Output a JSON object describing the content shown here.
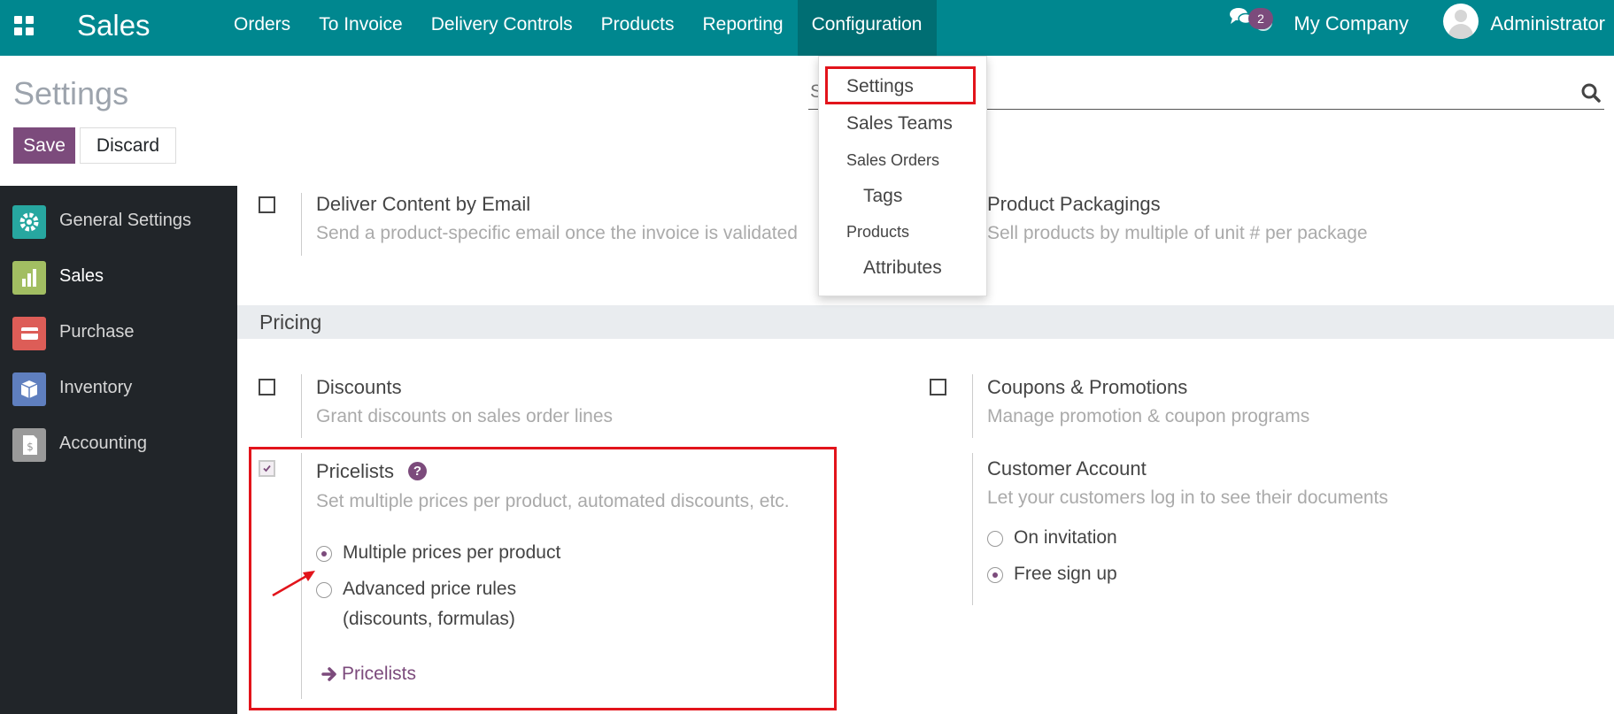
{
  "navbar": {
    "app_title": "Sales",
    "menu": [
      "Orders",
      "To Invoice",
      "Delivery Controls",
      "Products",
      "Reporting",
      "Configuration"
    ],
    "active_menu": "Configuration",
    "message_count": "2",
    "company": "My Company",
    "user": "Administrator"
  },
  "control_panel": {
    "title": "Settings",
    "save_label": "Save",
    "discard_label": "Discard",
    "search_placeholder": "S"
  },
  "sidebar": {
    "items": [
      {
        "label": "General Settings",
        "icon": "gear-icon",
        "color": "#27a7a0"
      },
      {
        "label": "Sales",
        "icon": "sales-chart-icon",
        "color": "#a2be62"
      },
      {
        "label": "Purchase",
        "icon": "credit-card-icon",
        "color": "#dd5d57"
      },
      {
        "label": "Inventory",
        "icon": "box-icon",
        "color": "#5f7fbf"
      },
      {
        "label": "Accounting",
        "icon": "invoice-dollar-icon",
        "color": "#9a9a9a"
      }
    ],
    "active": "Sales"
  },
  "dropdown": {
    "items": [
      "Settings",
      "Sales Teams",
      "Sales Orders",
      "Tags",
      "Products",
      "Attributes"
    ]
  },
  "settings": {
    "deliver_content": {
      "title": "Deliver Content by Email",
      "desc": "Send a product-specific email once the invoice is validated"
    },
    "product_packagings": {
      "title": "Product Packagings",
      "desc": "Sell products by multiple of unit # per package"
    },
    "pricing_section": "Pricing",
    "discounts": {
      "title": "Discounts",
      "desc": "Grant discounts on sales order lines"
    },
    "coupons": {
      "title": "Coupons & Promotions",
      "desc": "Manage promotion & coupon programs"
    },
    "pricelists": {
      "title": "Pricelists",
      "desc": "Set multiple prices per product, automated discounts, etc.",
      "option_multiple": "Multiple prices per product",
      "option_advanced_1": "Advanced price rules",
      "option_advanced_2": "(discounts, formulas)",
      "link": "Pricelists"
    },
    "customer_account": {
      "title": "Customer Account",
      "desc": "Let your customers log in to see their documents",
      "option_invitation": "On invitation",
      "option_signup": "Free sign up"
    }
  },
  "colors": {
    "navbar": "#00878f",
    "primary": "#7c4b7c",
    "highlight": "#e2141b"
  }
}
